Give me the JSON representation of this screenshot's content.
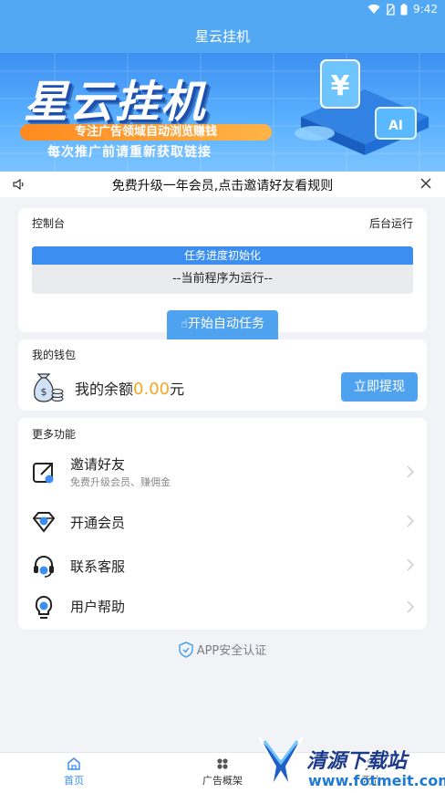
{
  "status_bar": {
    "time": "9:42"
  },
  "title_bar": {
    "title": "星云挂机"
  },
  "banner": {
    "title": "星云挂机",
    "tagline": "专注广告领域自动浏览赚钱",
    "subtitle": "每次推广前请重新获取链接"
  },
  "notice": {
    "text": "免费升级一年会员,点击邀请好友看规则"
  },
  "console": {
    "title": "控制台",
    "status": "后台运行",
    "progress_label": "任务进度初始化",
    "progress_fraction": 1.0,
    "run_text": "--当前程序为运行--",
    "start_button": "开始自动任务"
  },
  "wallet": {
    "title": "我的钱包",
    "balance_prefix": "我的余额",
    "balance_amount": "0.00",
    "balance_unit": "元",
    "withdraw_button": "立即提现"
  },
  "more": {
    "title": "更多功能",
    "items": [
      {
        "label": "邀请好友",
        "sub": "免费升级会员、赚佣金",
        "icon": "share-icon"
      },
      {
        "label": "开通会员",
        "sub": "",
        "icon": "vip-diamond-icon"
      },
      {
        "label": "联系客服",
        "sub": "",
        "icon": "headset-icon"
      },
      {
        "label": "用户帮助",
        "sub": "",
        "icon": "lightbulb-icon"
      }
    ]
  },
  "security": {
    "text": "APP安全认证"
  },
  "tabs": [
    {
      "label": "首页",
      "icon": "home-icon",
      "active": true
    },
    {
      "label": "广告概架",
      "icon": "grid-icon",
      "active": false
    },
    {
      "label": "我的",
      "icon": "user-icon",
      "active": false
    }
  ],
  "watermark": {
    "name": "清源下载站",
    "url": "www.fotmeit.com"
  },
  "colors": {
    "primary": "#4fa2f0",
    "accent": "#f5a623",
    "background": "#f2f3f7"
  }
}
